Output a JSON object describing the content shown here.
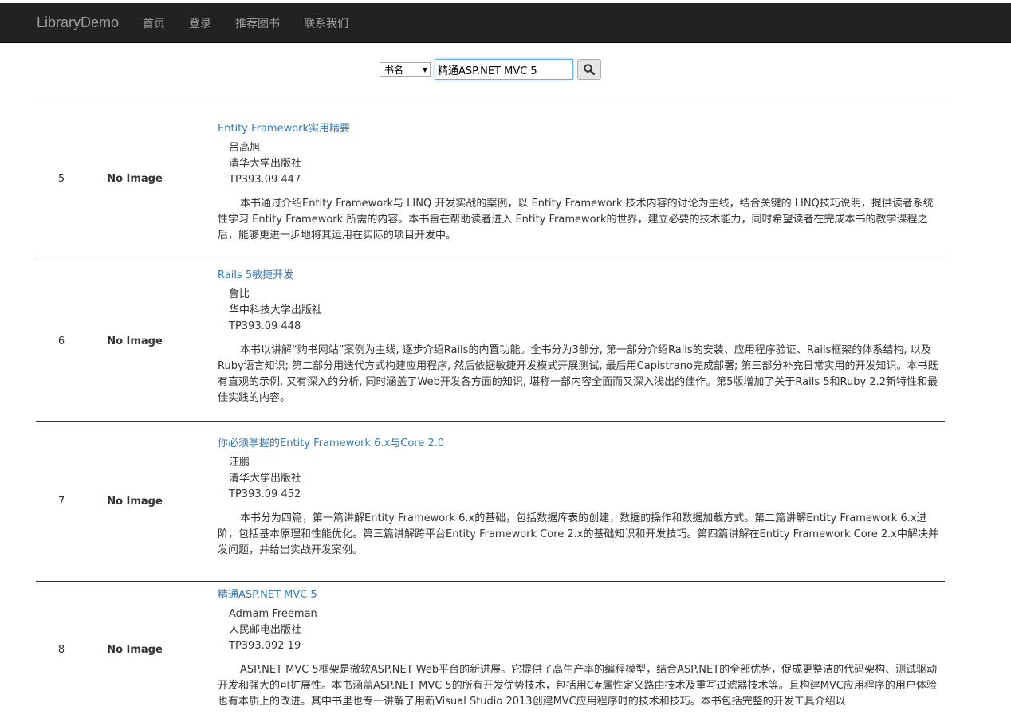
{
  "navbar": {
    "brand": "LibraryDemo",
    "links": [
      "首页",
      "登录",
      "推荐图书",
      "联系我们"
    ]
  },
  "search": {
    "field_selected": "书名",
    "query": "精通ASP.NET MVC 5"
  },
  "books": [
    {
      "index": "5",
      "image": "No Image",
      "title": "Entity Framework实用精要",
      "author": "吕高旭",
      "publisher": "清华大学出版社",
      "call_number": "TP393.09 447",
      "description": "本书通过介绍Entity Framework与 LINQ 开发实战的案例，以 Entity Framework 技术内容的讨论为主线，结合关键的 LINQ技巧说明，提供读者系统性学习 Entity Framework 所需的内容。本书旨在帮助读者进入 Entity Framework的世界，建立必要的技术能力，同时希望读者在完成本书的教学课程之后，能够更进一步地将其运用在实际的项目开发中。"
    },
    {
      "index": "6",
      "image": "No Image",
      "title": "Rails 5敏捷开发",
      "author": "鲁比",
      "publisher": "华中科技大学出版社",
      "call_number": "TP393.09 448",
      "description": "本书以讲解“购书网站”案例为主线, 逐步介绍Rails的内置功能。全书分为3部分, 第一部分介绍Rails的安装、应用程序验证、Rails框架的体系结构, 以及Ruby语言知识; 第二部分用迭代方式构建应用程序, 然后依据敏捷开发模式开展测试, 最后用Capistrano完成部署; 第三部分补充日常实用的开发知识。本书既有直观的示例, 又有深入的分析, 同时涵盖了Web开发各方面的知识, 堪称一部内容全面而又深入浅出的佳作。第5版增加了关于Rails 5和Ruby 2.2新特性和最佳实践的内容。"
    },
    {
      "index": "7",
      "image": "No Image",
      "title": "你必须掌握的Entity Framework 6.x与Core 2.0",
      "author": "汪鹏",
      "publisher": "清华大学出版社",
      "call_number": "TP393.09 452",
      "description": "本书分为四篇，第一篇讲解Entity Framework 6.x的基础，包括数据库表的创建，数据的操作和数据加载方式。第二篇讲解Entity Framework 6.x进阶，包括基本原理和性能优化。第三篇讲解跨平台Entity Framework Core 2.x的基础知识和开发技巧。第四篇讲解在Entity Framework Core 2.x中解决并发问题，并给出实战开发案例。"
    },
    {
      "index": "8",
      "image": "No Image",
      "title": "精通ASP.NET MVC 5",
      "author": "Admam Freeman",
      "publisher": "人民邮电出版社",
      "call_number": "TP393.092 19",
      "description": "ASP.NET MVC 5框架是微软ASP.NET Web平台的新进展。它提供了高生产率的编程模型，结合ASP.NET的全部优势，促成更整洁的代码架构、测试驱动开发和强大的可扩展性。本书涵盖ASP.NET MVC 5的所有开发优势技术，包括用C#属性定义路由技术及重写过滤器技术等。且构建MVC应用程序的用户体验也有本质上的改进。其中书里也专一讲解了用新Visual Studio 2013创建MVC应用程序时的技术和技巧。本书包括完整的开发工具介绍以"
    }
  ]
}
